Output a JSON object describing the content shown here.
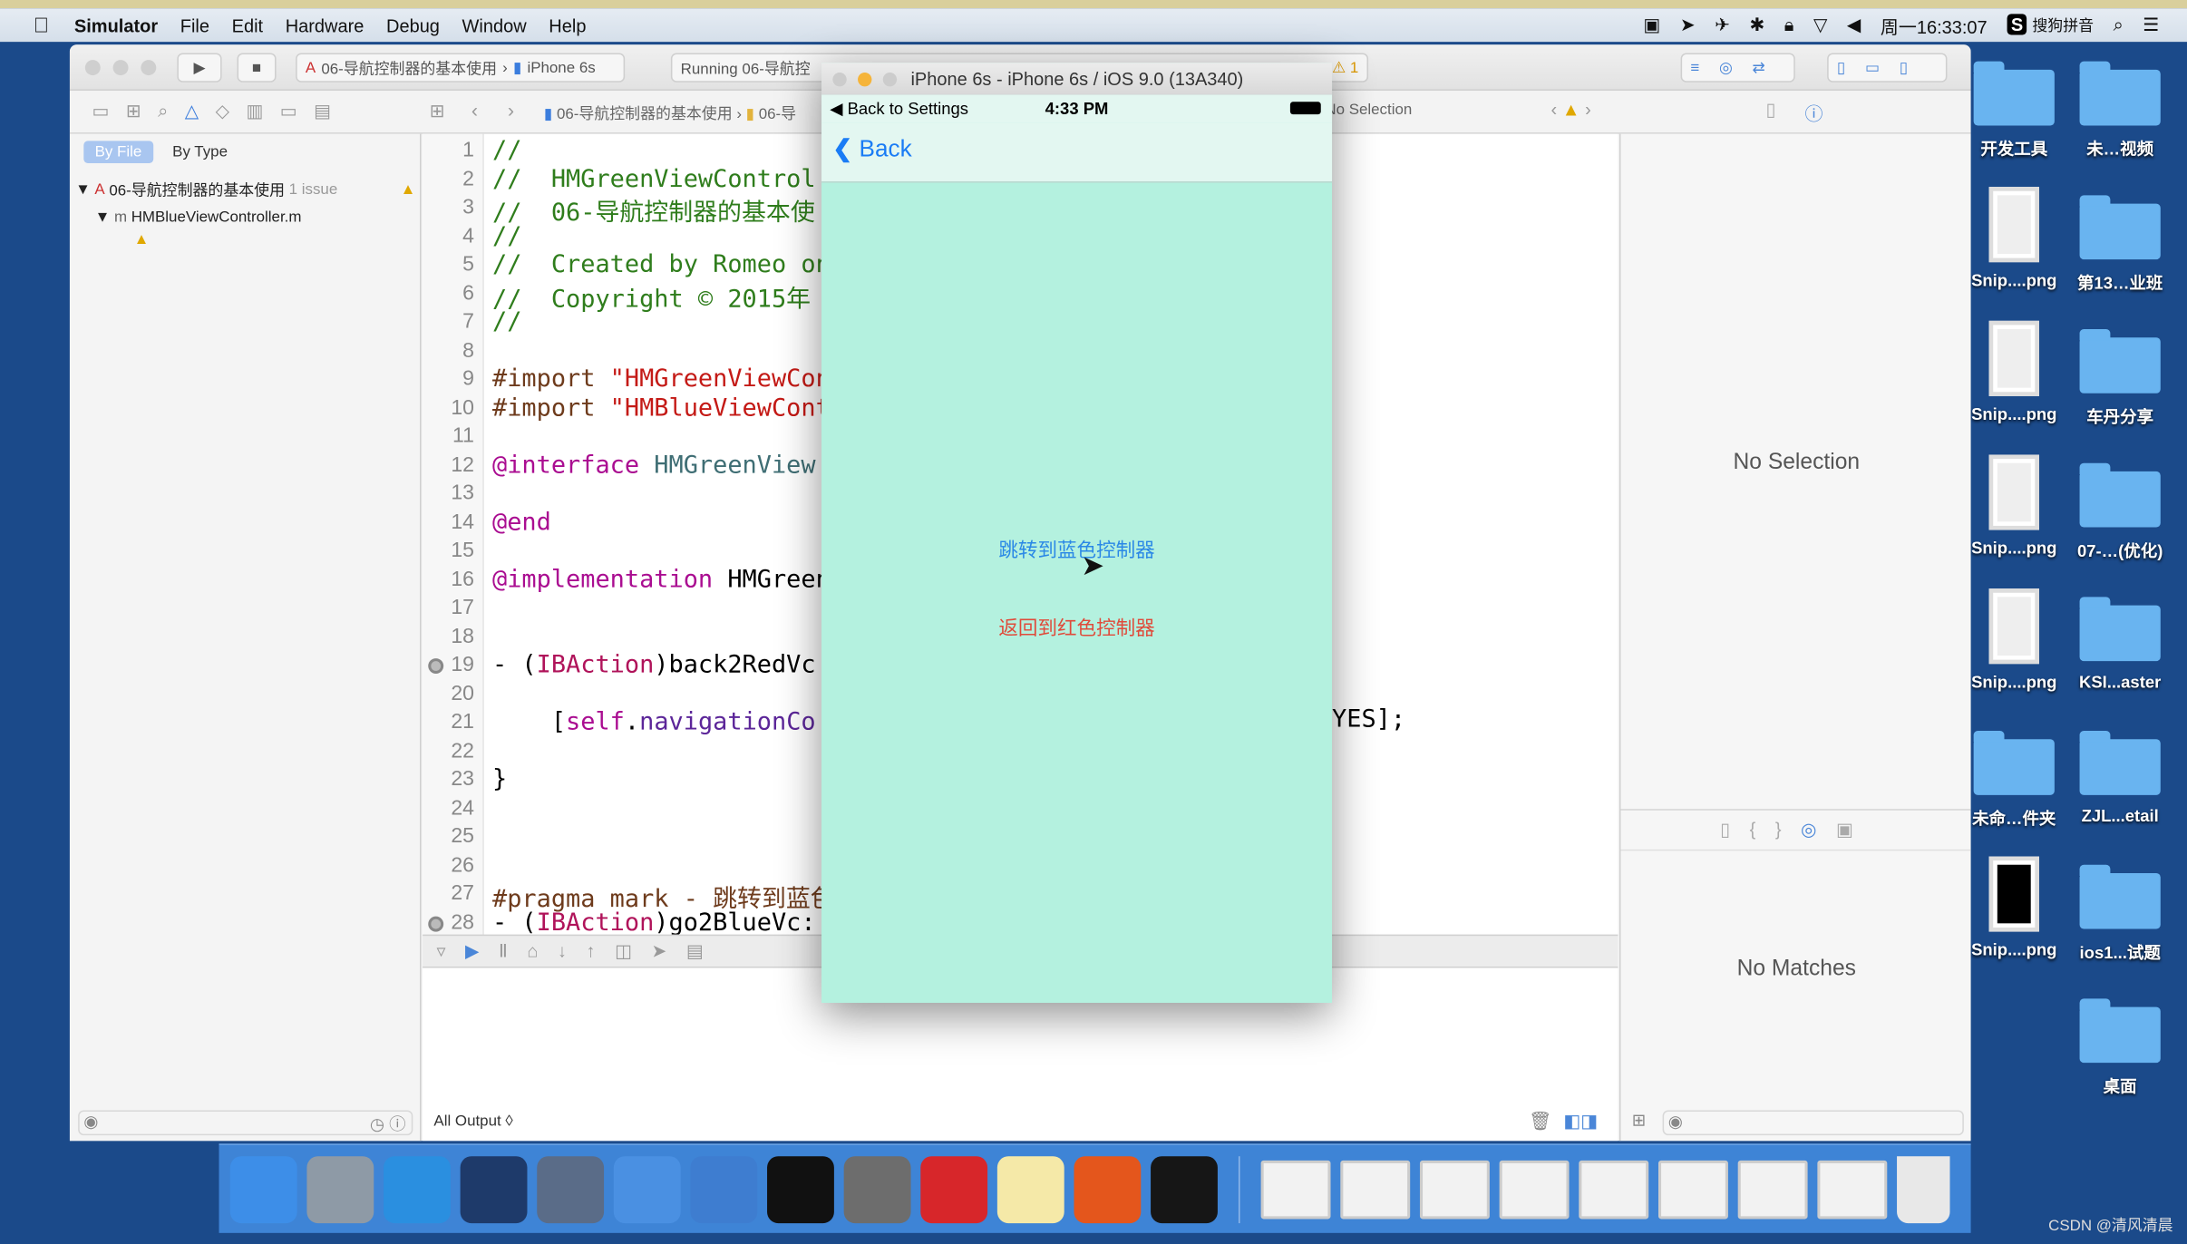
{
  "menubar": {
    "app": "Simulator",
    "items": [
      "File",
      "Edit",
      "Hardware",
      "Debug",
      "Window",
      "Help"
    ],
    "clock": "周一16:33:07",
    "ime": "搜狗拼音"
  },
  "toolbar": {
    "scheme": "06-导航控制器的基本使用",
    "device": "iPhone 6s",
    "status": "Running 06-导航控",
    "warning_count": "1"
  },
  "navigator": {
    "filter_tabs": [
      "By File",
      "By Type"
    ],
    "project": "06-导航控制器的基本使用",
    "issue_count": "1 issue",
    "file": "HMBlueViewController.m"
  },
  "jumpbar": {
    "path": "06-导航控制器的基本使用",
    "folder": "06-导",
    "no_selection": "No Selection"
  },
  "code": {
    "line_numbers": [
      "1",
      "2",
      "3",
      "4",
      "5",
      "6",
      "7",
      "8",
      "9",
      "10",
      "11",
      "12",
      "13",
      "14",
      "15",
      "16",
      "17",
      "18",
      "19",
      "20",
      "21",
      "22",
      "23",
      "24",
      "25",
      "26",
      "27",
      "28"
    ],
    "lines": [
      [
        {
          "t": "//",
          "c": "cm"
        }
      ],
      [
        {
          "t": "//  HMGreenViewControl",
          "c": "cm"
        }
      ],
      [
        {
          "t": "//  06-导航控制器的基本使",
          "c": "cm"
        }
      ],
      [
        {
          "t": "//",
          "c": "cm"
        }
      ],
      [
        {
          "t": "//  Created by Romeo on",
          "c": "cm"
        }
      ],
      [
        {
          "t": "//  Copyright © 2015年",
          "c": "cm"
        }
      ],
      [
        {
          "t": "//",
          "c": "cm"
        }
      ],
      [],
      [
        {
          "t": "#import ",
          "c": "pp"
        },
        {
          "t": "\"HMGreenViewCon",
          "c": "str"
        }
      ],
      [
        {
          "t": "#import ",
          "c": "pp"
        },
        {
          "t": "\"HMBlueViewCont",
          "c": "str"
        }
      ],
      [],
      [
        {
          "t": "@interface ",
          "c": "kw"
        },
        {
          "t": "HMGreenView",
          "c": "cls"
        }
      ],
      [],
      [
        {
          "t": "@end",
          "c": "kw"
        }
      ],
      [],
      [
        {
          "t": "@implementation ",
          "c": "kw"
        },
        {
          "t": "HMGreen",
          "c": ""
        }
      ],
      [],
      [],
      [
        {
          "t": "- (",
          "c": ""
        },
        {
          "t": "IBAction",
          "c": "act"
        },
        {
          "t": ")back2RedVc",
          "c": ""
        }
      ],
      [],
      [
        {
          "t": "    [",
          "c": ""
        },
        {
          "t": "self",
          "c": "kw"
        },
        {
          "t": ".",
          "c": ""
        },
        {
          "t": "navigationCo",
          "c": "mth"
        }
      ],
      [],
      [
        {
          "t": "}",
          "c": ""
        }
      ],
      [],
      [],
      [],
      [
        {
          "t": "#pragma mark - 跳转到蓝色",
          "c": "pp"
        }
      ],
      [
        {
          "t": "- (",
          "c": ""
        },
        {
          "t": "IBAction",
          "c": "act"
        },
        {
          "t": ")go2BlueVc:",
          "c": ""
        }
      ]
    ],
    "line21_tail": "YES];"
  },
  "console": {
    "output_filter": "All Output ◊"
  },
  "inspector": {
    "no_selection": "No Selection",
    "no_matches": "No Matches"
  },
  "simulator": {
    "title": "iPhone 6s - iPhone 6s / iOS 9.0 (13A340)",
    "back_to_app": "◀ Back to Settings",
    "time": "4:33 PM",
    "back_button": "Back",
    "go_blue_button": "跳转到蓝色控制器",
    "back_red_button": "返回到红色控制器",
    "bg_color": "#b4f1df"
  },
  "desktop": {
    "items": [
      {
        "name": "开发工具",
        "type": "folder"
      },
      {
        "name": "未…视频",
        "type": "folder"
      },
      {
        "name": "Snip....png",
        "type": "image"
      },
      {
        "name": "第13…业班",
        "type": "folder"
      },
      {
        "name": "Snip....png",
        "type": "image"
      },
      {
        "name": "车丹分享",
        "type": "folder"
      },
      {
        "name": "Snip....png",
        "type": "image"
      },
      {
        "name": "07-…(优化)",
        "type": "folder"
      },
      {
        "name": "Snip....png",
        "type": "image"
      },
      {
        "name": "KSI...aster",
        "type": "folder"
      },
      {
        "name": "未命…件夹",
        "type": "folder"
      },
      {
        "name": "ZJL...etail",
        "type": "folder"
      },
      {
        "name": "Snip....png",
        "type": "image"
      },
      {
        "name": "ios1...试题",
        "type": "folder"
      },
      {
        "name": "",
        "type": "none"
      },
      {
        "name": "桌面",
        "type": "folder"
      }
    ]
  },
  "dock": {
    "apps": [
      {
        "name": "finder",
        "color": "#3d8ee8"
      },
      {
        "name": "launchpad",
        "color": "#8e9aa6"
      },
      {
        "name": "safari",
        "color": "#2a8fe0"
      },
      {
        "name": "mouse",
        "color": "#1e3a6a"
      },
      {
        "name": "imovie",
        "color": "#5a6c88"
      },
      {
        "name": "xcode",
        "color": "#4a90e2"
      },
      {
        "name": "instruments",
        "color": "#3e7dd0"
      },
      {
        "name": "terminal",
        "color": "#111111"
      },
      {
        "name": "system-preferences",
        "color": "#6d6d6d"
      },
      {
        "name": "xmind",
        "color": "#d7262a"
      },
      {
        "name": "notes",
        "color": "#f5e9a8"
      },
      {
        "name": "powerpoint-like",
        "color": "#e4561c"
      },
      {
        "name": "console",
        "color": "#161616"
      }
    ],
    "docs": [
      "doc1",
      "doc2",
      "doc3",
      "doc4",
      "doc5",
      "doc6",
      "doc7",
      "doc8"
    ],
    "trash": "trash"
  },
  "watermark": "CSDN @清风清晨"
}
